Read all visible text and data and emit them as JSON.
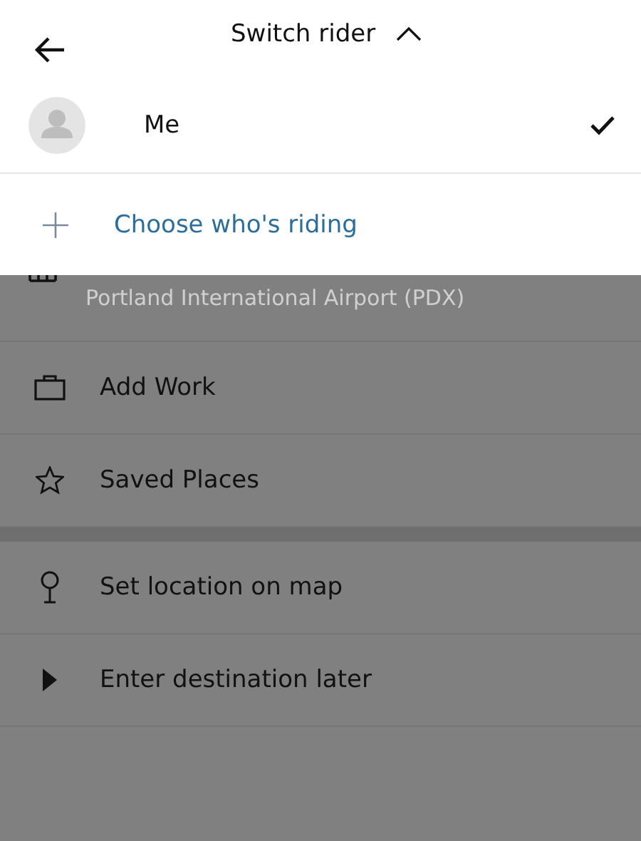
{
  "header": {
    "title": "Switch rider",
    "expanded": true
  },
  "riders": [
    {
      "name": "Me",
      "selected": true
    }
  ],
  "add_rider": {
    "label": "Choose who's riding"
  },
  "places": [
    {
      "kind": "airport",
      "subtitle": "Portland International Airport (PDX)"
    },
    {
      "kind": "work",
      "label": "Add Work"
    },
    {
      "kind": "saved",
      "label": "Saved Places"
    }
  ],
  "actions": [
    {
      "kind": "map",
      "label": "Set location on map"
    },
    {
      "kind": "later",
      "label": "Enter destination later"
    }
  ]
}
